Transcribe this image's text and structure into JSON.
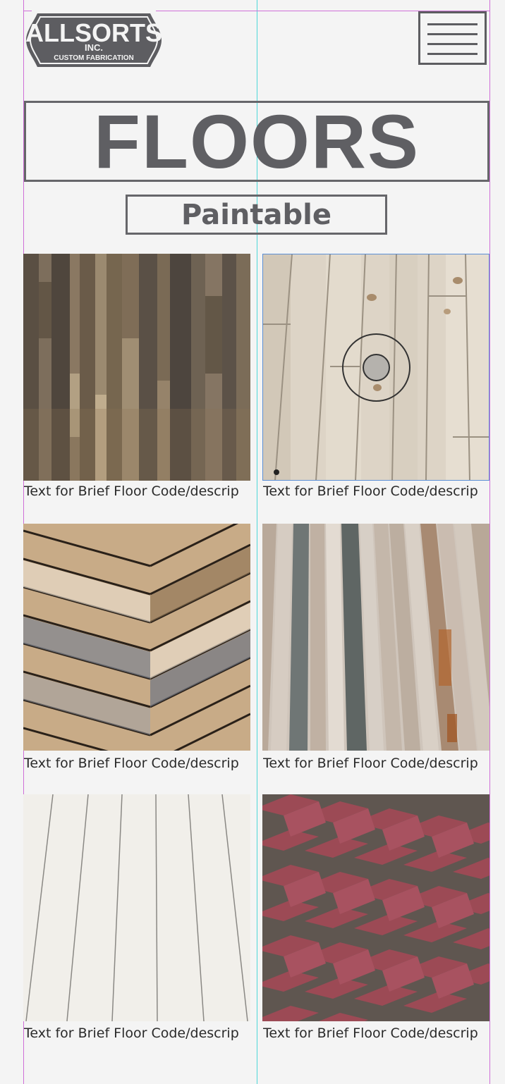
{
  "header": {
    "logo": {
      "name": "ALLSORTS",
      "suffix": "INC.",
      "tagline": "CUSTOM FABRICATION"
    },
    "menu_icon": "hamburger-menu-icon"
  },
  "page": {
    "title": "FLOORS",
    "subtitle": "Paintable"
  },
  "floors": [
    {
      "caption": "Text for Brief Floor Code/descrip",
      "texture": "dark-reclaimed-planks"
    },
    {
      "caption": "Text for Brief Floor Code/descrip",
      "texture": "light-pine-planks"
    },
    {
      "caption": "Text for Brief Floor Code/descrip",
      "texture": "herringbone-wood"
    },
    {
      "caption": "Text for Brief Floor Code/descrip",
      "texture": "painted-reclaimed-strips"
    },
    {
      "caption": "Text for Brief Floor Code/descrip",
      "texture": "white-painted-planks"
    },
    {
      "caption": "Text for Brief Floor Code/descrip",
      "texture": "red-herringbone-brick"
    }
  ],
  "colors": {
    "text": "#5f5f63",
    "background": "#f4f4f4",
    "guide_magenta": "#cf6fd8",
    "guide_cyan": "#4dd7d8"
  }
}
